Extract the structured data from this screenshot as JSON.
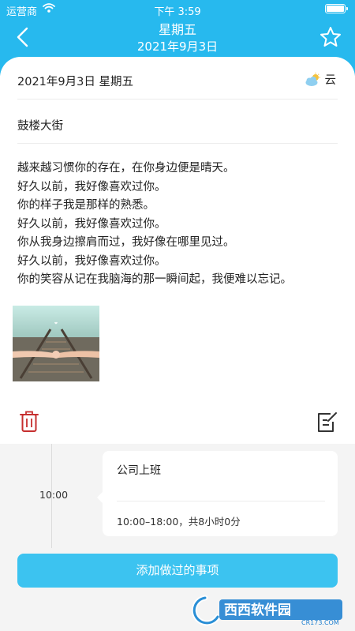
{
  "status_bar": {
    "carrier": "运营商",
    "time": "下午 3:59"
  },
  "header": {
    "title": "星期五",
    "subtitle": "2021年9月3日"
  },
  "entry": {
    "date": "2021年9月3日  星期五",
    "weather": "云",
    "location": "鼓楼大街",
    "lines": [
      "越来越习惯你的存在，在你身边便是晴天。",
      "好久以前，我好像喜欢过你。",
      "你的样子我是那样的熟悉。",
      "好久以前，我好像喜欢过你。",
      "你从我身边擦肩而过，我好像在哪里见过。",
      "好久以前，我好像喜欢过你。",
      "你的笑容从记在我脑海的那一瞬间起，我便难以忘记。"
    ]
  },
  "timeline": {
    "time": "10:00",
    "event_title": "公司上班",
    "event_meta": "10:00–18:00，共8小时0分"
  },
  "add_button_label": "添加做过的事项",
  "watermark": {
    "brand": "西西软件园",
    "domain": "CR173.COM"
  },
  "colors": {
    "header": "#27b9ee",
    "button": "#3cc3f0",
    "delete": "#c62f2f"
  },
  "icons": [
    "back-icon",
    "star-icon",
    "weather-cloud-icon",
    "trash-icon",
    "edit-icon"
  ]
}
